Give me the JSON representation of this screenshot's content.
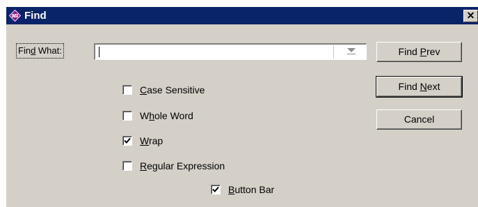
{
  "window": {
    "title": "Find",
    "app_icon": "cvi-app-icon",
    "close_glyph": "✕"
  },
  "find_what": {
    "label_pre": "Fin",
    "label_accel": "d",
    "label_post": " What:",
    "value": "",
    "dropdown_icon": "chevron-down-icon"
  },
  "options": [
    {
      "pre": "",
      "accel": "C",
      "post": "ase Sensitive",
      "checked": false
    },
    {
      "pre": "W",
      "accel": "h",
      "post": "ole Word",
      "checked": false
    },
    {
      "pre": "",
      "accel": "W",
      "post": "rap",
      "checked": true
    },
    {
      "pre": "",
      "accel": "R",
      "post": "egular Expression",
      "checked": false
    }
  ],
  "button_bar": {
    "pre": "",
    "accel": "B",
    "post": "utton Bar",
    "checked": true
  },
  "buttons": {
    "find_prev": {
      "pre": "Find ",
      "accel": "P",
      "post": "rev"
    },
    "find_next": {
      "pre": "Find ",
      "accel": "N",
      "post": "ext"
    },
    "cancel": {
      "label": "Cancel"
    }
  },
  "colors": {
    "titlebar": "#0a246a",
    "dialog_face": "#d4d0c8",
    "app_icon_fill": "#8b1a89"
  }
}
